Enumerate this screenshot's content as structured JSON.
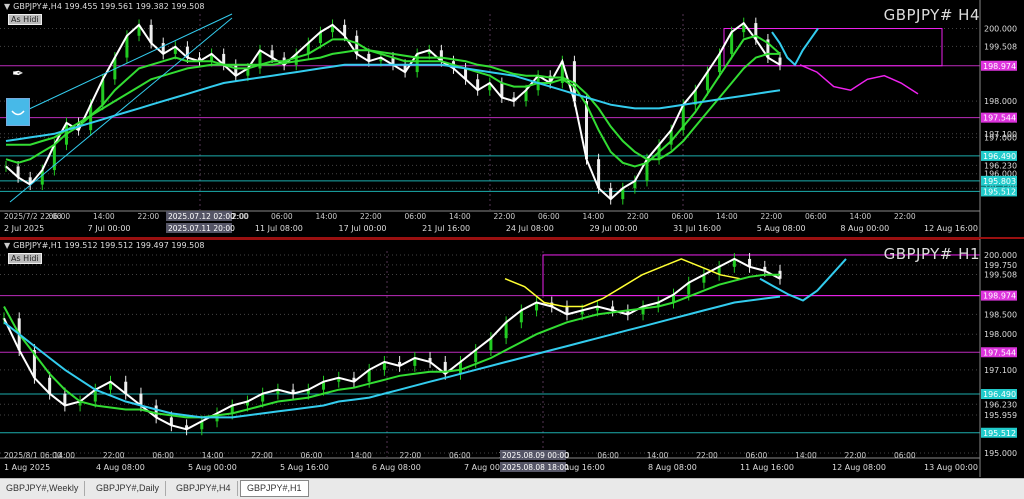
{
  "window_tabs": [
    "GBPJPY#,Weekly",
    "GBPJPY#,Daily",
    "GBPJPY#,H4",
    "GBPJPY#,H1"
  ],
  "active_tab": 3,
  "colors": {
    "bg": "#000000",
    "price": "#ffffff",
    "fast_ma": "#ffff33",
    "mid_ma": "#33dd33",
    "slow_ma": "#33ccee",
    "magenta": "#ee22ee",
    "tag_pink": "#dd33dd",
    "tag_cyan": "#22cccc"
  },
  "chart_data": [
    {
      "type": "line",
      "title": "GBPJPY# H4",
      "header": "GBPJPY#,H4  199.455 199.561 199.382 199.508",
      "as_hide": "As Hidi",
      "ylim": [
        195.0,
        200.4
      ],
      "y_ticks": [
        200.0,
        199.508,
        198.0,
        197.1,
        197.0,
        196.23,
        196.0,
        195.6
      ],
      "price_tags": [
        {
          "value": 198.974,
          "label": "198.974",
          "color": "#dd33dd"
        },
        {
          "value": 197.544,
          "label": "197.544",
          "color": "#dd33dd"
        },
        {
          "value": 196.49,
          "label": "196.490",
          "color": "#22cccc"
        },
        {
          "value": 195.803,
          "label": "195.803",
          "color": "#22cccc"
        },
        {
          "value": 195.512,
          "label": "195.512",
          "color": "#22cccc"
        }
      ],
      "x_tick_labels": [
        "2 Jul 2025",
        "7 Jul 00:00",
        "9 Jul 16:00",
        "11 Jul 08:00",
        "17 Jul 00:00",
        "21 Jul 16:00",
        "24 Jul 08:00",
        "29 Jul 00:00",
        "31 Jul 16:00",
        "5 Aug 08:00",
        "8 Aug 00:00",
        "12 Aug 16:00"
      ],
      "x_small_labels": [
        "2025/7/2 22:00",
        "06:00",
        "14:00",
        "22:00",
        "2025.07.12 02:00",
        "22:00",
        "06:00",
        "14:00",
        "22:00",
        "06:00",
        "14:00",
        "22:00",
        "06:00",
        "14:00",
        "22:00",
        "06:00",
        "14:00",
        "22:00",
        "06:00",
        "14:00",
        "22:00"
      ],
      "marker_labels": [
        "2025.07.12 02:00",
        "2025.07.11 20:00"
      ],
      "series": [
        {
          "values": [
            196.2,
            195.9,
            195.7,
            196.1,
            196.8,
            197.4,
            197.2,
            197.9,
            198.6,
            199.2,
            199.8,
            200.1,
            199.6,
            199.3,
            199.5,
            199.2,
            199.1,
            199.3,
            199.0,
            198.7,
            198.9,
            199.4,
            199.2,
            199.0,
            199.3,
            199.6,
            199.9,
            200.1,
            199.8,
            199.3,
            199.1,
            199.2,
            199.0,
            198.8,
            199.3,
            199.4,
            199.1,
            198.9,
            198.6,
            198.3,
            198.5,
            198.1,
            198.0,
            198.3,
            198.7,
            198.5,
            199.1,
            198.0,
            196.4,
            195.6,
            195.3,
            195.6,
            195.8,
            196.4,
            196.8,
            197.2,
            197.9,
            198.3,
            198.8,
            199.3,
            199.9,
            200.15,
            199.7,
            199.2,
            199.0
          ]
        },
        {
          "values": [
            196.4,
            196.3,
            196.4,
            196.6,
            196.8,
            197.1,
            197.3,
            197.6,
            197.9,
            198.3,
            198.6,
            198.9,
            199.0,
            199.1,
            199.2,
            199.1,
            199.1,
            199.1,
            199.0,
            198.9,
            198.9,
            199.0,
            199.1,
            199.1,
            199.2,
            199.3,
            199.5,
            199.7,
            199.7,
            199.6,
            199.4,
            199.3,
            199.2,
            199.1,
            199.1,
            199.1,
            199.1,
            199.0,
            198.9,
            198.8,
            198.7,
            198.5,
            198.4,
            198.4,
            198.5,
            198.5,
            198.6,
            198.4,
            197.9,
            197.2,
            196.6,
            196.3,
            196.2,
            196.3,
            196.6,
            196.9,
            197.3,
            197.7,
            198.2,
            198.7,
            199.2,
            199.7,
            199.8,
            199.6,
            199.3
          ]
        },
        {
          "values": [
            196.8,
            196.8,
            196.8,
            196.9,
            197.0,
            197.2,
            197.4,
            197.6,
            197.8,
            198.0,
            198.2,
            198.4,
            198.6,
            198.7,
            198.8,
            198.9,
            198.95,
            199.0,
            199.0,
            199.0,
            199.0,
            199.0,
            199.0,
            199.05,
            199.1,
            199.15,
            199.2,
            199.3,
            199.35,
            199.4,
            199.4,
            199.35,
            199.3,
            199.25,
            199.2,
            199.2,
            199.2,
            199.15,
            199.1,
            199.0,
            198.95,
            198.85,
            198.75,
            198.7,
            198.7,
            198.65,
            198.65,
            198.5,
            198.2,
            197.8,
            197.3,
            196.9,
            196.6,
            196.4,
            196.4,
            196.6,
            196.9,
            197.3,
            197.7,
            198.1,
            198.5,
            198.9,
            199.2,
            199.3,
            199.3
          ]
        },
        {
          "values": [
            196.9,
            196.95,
            197.0,
            197.05,
            197.1,
            197.2,
            197.3,
            197.4,
            197.5,
            197.6,
            197.7,
            197.8,
            197.9,
            198.0,
            198.1,
            198.2,
            198.3,
            198.4,
            198.5,
            198.55,
            198.6,
            198.65,
            198.7,
            198.75,
            198.8,
            198.85,
            198.9,
            198.95,
            199.0,
            199.0,
            199.0,
            199.0,
            199.0,
            199.0,
            199.0,
            199.0,
            199.0,
            198.95,
            198.9,
            198.85,
            198.8,
            198.75,
            198.7,
            198.6,
            198.5,
            198.4,
            198.3,
            198.2,
            198.1,
            198.0,
            197.9,
            197.85,
            197.8,
            197.8,
            197.8,
            197.85,
            197.9,
            197.95,
            198.0,
            198.05,
            198.1,
            198.15,
            198.2,
            198.25,
            198.3
          ]
        },
        {
          "values": [
            199.9,
            199.6,
            199.2,
            199.0,
            199.4,
            199.7,
            200.0
          ]
        },
        {
          "values": [
            199.0,
            198.8,
            198.4,
            198.3,
            198.6,
            198.7,
            198.5,
            198.2
          ]
        }
      ]
    },
    {
      "type": "line",
      "title": "GBPJPY# H1",
      "header": "GBPJPY#,H1  199.512 199.512 199.497 199.508",
      "as_hide": "As Hidi",
      "ylim": [
        194.9,
        200.1
      ],
      "y_ticks": [
        200.0,
        199.75,
        199.508,
        198.5,
        198.0,
        197.1,
        196.23,
        195.959,
        195.0
      ],
      "price_tags": [
        {
          "value": 198.974,
          "label": "198.974",
          "color": "#dd33dd"
        },
        {
          "value": 197.544,
          "label": "197.544",
          "color": "#dd33dd"
        },
        {
          "value": 196.49,
          "label": "196.490",
          "color": "#22cccc"
        },
        {
          "value": 195.512,
          "label": "195.512",
          "color": "#22cccc"
        }
      ],
      "x_tick_labels": [
        "1 Aug 2025",
        "4 Aug 08:00",
        "5 Aug 00:00",
        "5 Aug 16:00",
        "6 Aug 08:00",
        "7 Aug 00:00",
        "7 Aug 16:00",
        "8 Aug 08:00",
        "11 Aug 16:00",
        "12 Aug 08:00",
        "13 Aug 00:00"
      ],
      "x_small_labels": [
        "2025/8/1 06:00",
        "14:00",
        "22:00",
        "06:00",
        "14:00",
        "22:00",
        "06:00",
        "14:00",
        "22:00",
        "06:00",
        "14:00",
        "22:00",
        "06:00",
        "14:00",
        "22:00",
        "06:00",
        "14:00",
        "22:00",
        "06:00"
      ],
      "marker_labels": [
        "2025.08.09 00:00",
        "2025.08.08 18:00"
      ],
      "series": [
        {
          "values": [
            198.4,
            197.6,
            196.9,
            196.5,
            196.2,
            196.3,
            196.6,
            196.8,
            196.5,
            196.2,
            195.9,
            195.7,
            195.6,
            195.8,
            196.0,
            196.2,
            196.3,
            196.5,
            196.6,
            196.5,
            196.6,
            196.8,
            196.9,
            196.8,
            197.1,
            197.3,
            197.2,
            197.4,
            197.3,
            197.0,
            197.3,
            197.6,
            197.9,
            198.3,
            198.6,
            198.8,
            198.7,
            198.5,
            198.6,
            198.7,
            198.6,
            198.5,
            198.7,
            198.8,
            199.0,
            199.3,
            199.5,
            199.7,
            199.9,
            199.7,
            199.6,
            199.4
          ]
        },
        {
          "values": [
            199.4,
            199.2,
            198.8,
            198.7,
            198.7,
            198.9,
            199.2,
            199.5,
            199.7,
            199.9,
            199.7,
            199.5,
            199.4
          ]
        },
        {
          "values": [
            198.7,
            198.0,
            197.5,
            197.0,
            196.6,
            196.3,
            196.2,
            196.15,
            196.1,
            196.1,
            196.0,
            195.95,
            195.9,
            195.9,
            195.95,
            196.0,
            196.1,
            196.2,
            196.3,
            196.35,
            196.4,
            196.5,
            196.6,
            196.65,
            196.75,
            196.85,
            196.95,
            197.0,
            197.05,
            197.05,
            197.1,
            197.25,
            197.4,
            197.6,
            197.8,
            198.0,
            198.15,
            198.3,
            198.4,
            198.5,
            198.55,
            198.6,
            198.65,
            198.7,
            198.8,
            198.95,
            199.1,
            199.25,
            199.35,
            199.45,
            199.5,
            199.5
          ]
        },
        {
          "values": [
            198.3,
            198.0,
            197.7,
            197.4,
            197.1,
            196.85,
            196.6,
            196.45,
            196.3,
            196.2,
            196.1,
            196.0,
            195.95,
            195.9,
            195.9,
            195.9,
            195.95,
            196.0,
            196.05,
            196.1,
            196.15,
            196.2,
            196.3,
            196.35,
            196.4,
            196.5,
            196.6,
            196.7,
            196.8,
            196.9,
            197.0,
            197.1,
            197.2,
            197.3,
            197.4,
            197.5,
            197.6,
            197.7,
            197.8,
            197.9,
            198.0,
            198.1,
            198.2,
            198.3,
            198.4,
            198.5,
            198.6,
            198.7,
            198.8,
            198.85,
            198.9,
            198.95
          ]
        },
        {
          "values": [
            199.4,
            199.2,
            199.0,
            198.85,
            199.1,
            199.5,
            199.9
          ]
        }
      ]
    }
  ]
}
